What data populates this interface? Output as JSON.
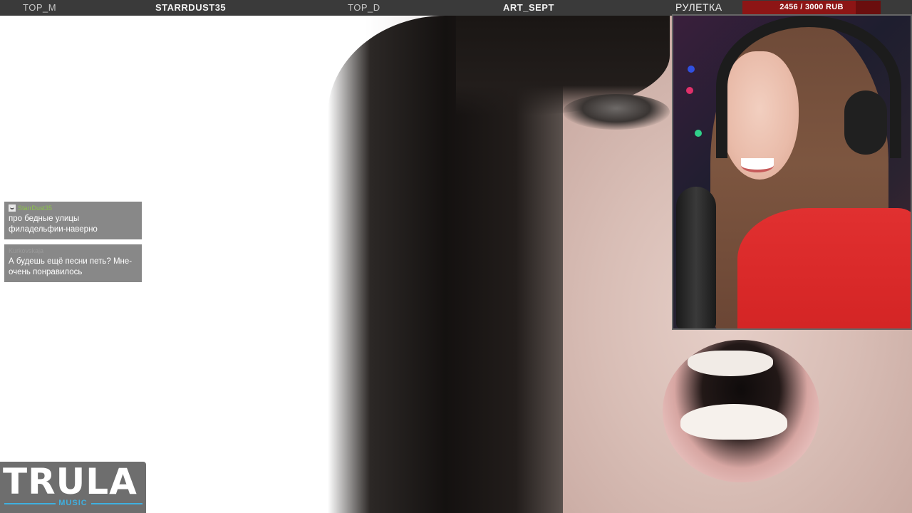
{
  "topbar": {
    "tabs": [
      {
        "label": "TOP_M"
      },
      {
        "label": "STARRDUST35"
      },
      {
        "label": "TOP_D"
      },
      {
        "label": "ART_SEPT"
      },
      {
        "label": "РУЛЕТКА"
      }
    ],
    "progress": {
      "label": "2456 / 3000 RUB",
      "current": 2456,
      "goal": 3000,
      "fraction": 0.819
    }
  },
  "chat": {
    "messages": [
      {
        "username": "StarrDust35",
        "text": "про бедные улицы филадельфии-наверно"
      },
      {
        "username": "Kurkovskaja",
        "text": "А будешь ещё песни петь? Мне-очень понравилось"
      }
    ]
  },
  "logo": {
    "word": "TRULA",
    "sub": "MUSIC"
  },
  "colors": {
    "topbar_bg": "#3a3a3a",
    "progress_bg": "#6a0e0e",
    "progress_fill": "#8d1515",
    "chat_bg": "#6e6e6e",
    "logo_accent": "#3fb0e0",
    "username_green": "#8bc34a"
  },
  "icons": {
    "chat_user": "smiley-avatar-icon"
  }
}
